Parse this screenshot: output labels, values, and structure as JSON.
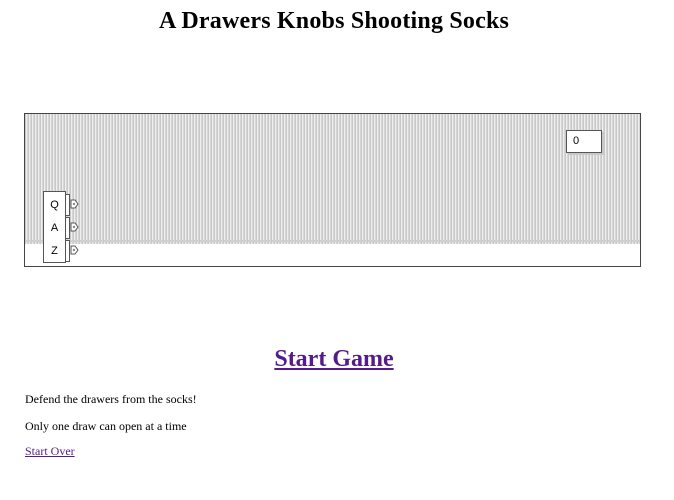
{
  "page": {
    "title": "A Drawers Knobs Shooting Socks"
  },
  "game": {
    "score": "0",
    "drawers": [
      {
        "key": "Q"
      },
      {
        "key": "A"
      },
      {
        "key": "Z"
      }
    ]
  },
  "links": {
    "start_game": "Start Game",
    "start_over": "Start Over"
  },
  "instructions": {
    "line1": "Defend the drawers from the socks!",
    "line2": "Only one draw can open at a time"
  },
  "colors": {
    "link_visited": "#551a8b",
    "board_border": "#444444",
    "sock_texture": "#c8c8c8"
  },
  "icons": {
    "knob": "drawer-knob-icon"
  }
}
